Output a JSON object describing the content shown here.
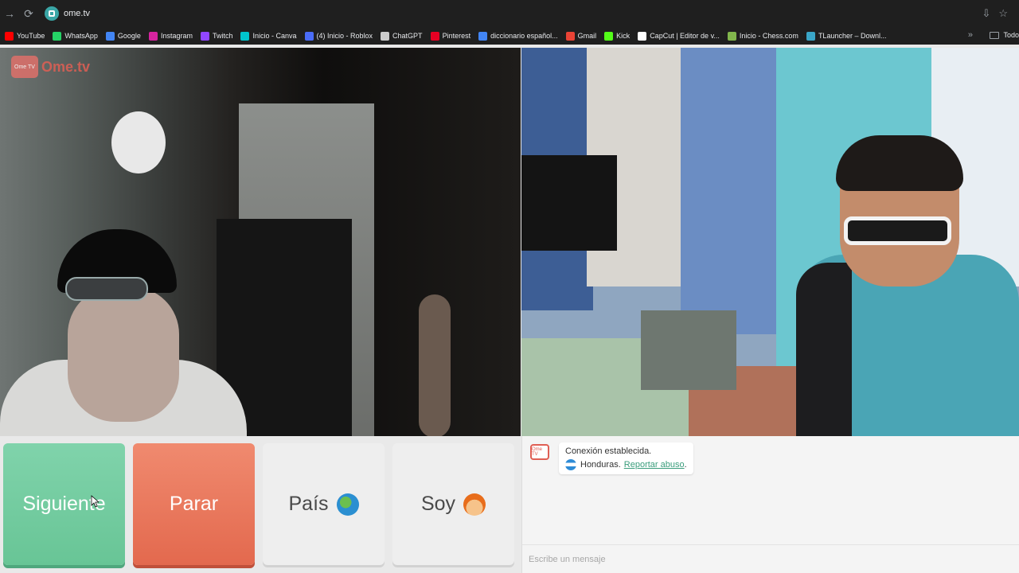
{
  "browser": {
    "url": "ome.tv",
    "bookmarks": [
      {
        "label": "YouTube",
        "color": "#ff0000"
      },
      {
        "label": "WhatsApp",
        "color": "#25d366"
      },
      {
        "label": "Google",
        "color": "#4285f4"
      },
      {
        "label": "Instagram",
        "color": "#d6249f"
      },
      {
        "label": "Twitch",
        "color": "#9146ff"
      },
      {
        "label": "Inicio - Canva",
        "color": "#00c4cc"
      },
      {
        "label": "(4) Inicio - Roblox",
        "color": "#4a6cf7"
      },
      {
        "label": "ChatGPT",
        "color": "#cccccc"
      },
      {
        "label": "Pinterest",
        "color": "#e60023"
      },
      {
        "label": "diccionario español...",
        "color": "#4285f4"
      },
      {
        "label": "Gmail",
        "color": "#ea4335"
      },
      {
        "label": "Kick",
        "color": "#53fc18"
      },
      {
        "label": "CapCut | Editor de v...",
        "color": "#ffffff"
      },
      {
        "label": "Inicio - Chess.com",
        "color": "#81b64c"
      },
      {
        "label": "TLauncher – Downl...",
        "color": "#3aa6c8"
      }
    ],
    "more_folder": "Todo"
  },
  "site": {
    "logo_tv": "Ome TV",
    "logo_name": "Ome.tv"
  },
  "controls": {
    "next_label": "Siguiente",
    "stop_label": "Parar",
    "country_label": "País",
    "me_label": "Soy"
  },
  "chat": {
    "logo": "Ome TV",
    "status": "Conexión establecida.",
    "country": "Honduras.",
    "report_label": "Reportar abuso",
    "report_suffix": ".",
    "placeholder": "Escribe un mensaje"
  },
  "colors": {
    "next": "#6cc79a",
    "stop": "#e86c52",
    "accent": "#e05f54"
  }
}
